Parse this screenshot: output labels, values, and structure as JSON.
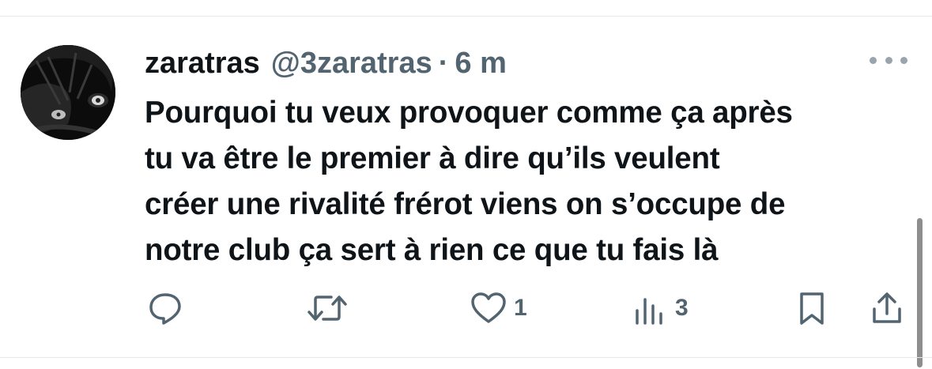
{
  "tweet": {
    "author_name": "zaratras",
    "handle": "@3zaratras",
    "separator": "·",
    "time": "6 m",
    "text_lines": [
      "Pourquoi tu veux provoquer comme ça après",
      "tu va être le premier à dire qu’ils veulent",
      "créer une rivalité frérot viens on s’occupe de",
      "notre club ça sert à rien ce que tu fais là"
    ]
  },
  "actions": {
    "reply": {
      "icon": "reply-icon"
    },
    "repost": {
      "icon": "repost-icon"
    },
    "like": {
      "icon": "heart-icon",
      "count": "1"
    },
    "views": {
      "icon": "views-icon",
      "count": "3"
    },
    "bookmark": {
      "icon": "bookmark-icon"
    },
    "share": {
      "icon": "share-icon"
    }
  },
  "colors": {
    "text": "#0f1419",
    "secondary": "#536471",
    "divider": "#e6e9ec"
  }
}
